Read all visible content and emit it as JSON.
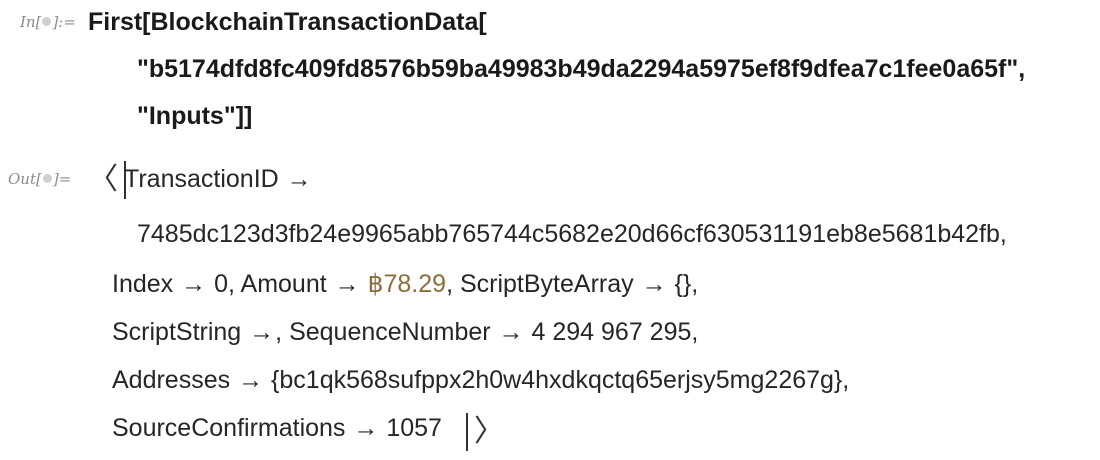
{
  "input": {
    "label_prefix": "In[",
    "label_suffix": "]:=",
    "line1": "First[BlockchainTransactionData[",
    "line2": "\"b5174dfd8fc409fd8576b59ba49983b49da2294a5975ef8f9dfea7c1fee0a65f\",",
    "line3": "\"Inputs\"]]"
  },
  "output": {
    "label_prefix": "Out[",
    "label_suffix": "]=",
    "open_angle": "〈",
    "close_angle": "〉",
    "transaction_id_key": "TransactionID",
    "arrow": "→",
    "transaction_id_value": "7485dc123d3fb24e9965abb765744c5682e20d66cf630531191eb8e5681b42fb,",
    "index_key": "Index",
    "index_value": "0,",
    "amount_key": "Amount",
    "amount_value": "฿78.29",
    "script_byte_array_key": "ScriptByteArray",
    "script_byte_array_value": "{},",
    "script_string_key": "ScriptString",
    "script_string_value": ",",
    "sequence_number_key": "SequenceNumber",
    "sequence_number_value": "4 294 967 295,",
    "addresses_key": "Addresses",
    "addresses_value": "{bc1qk568sufppx2h0w4hxdkqctq65erjsy5mg2267g},",
    "source_confirmations_key": "SourceConfirmations",
    "source_confirmations_value": "1057"
  }
}
